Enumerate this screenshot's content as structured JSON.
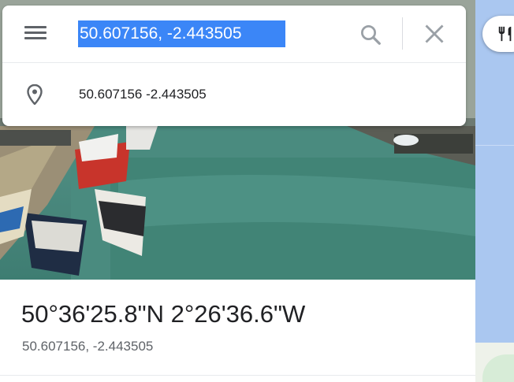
{
  "search": {
    "query": "50.607156, -2.443505",
    "menu_icon": "hamburger-menu-icon",
    "search_icon": "search-icon",
    "close_icon": "close-icon"
  },
  "suggestion": {
    "icon": "location-pin-icon",
    "text": "50.607156 -2.443505"
  },
  "place": {
    "title": "50°36'25.8\"N 2°26'36.6\"W",
    "coordinates": "50.607156, -2.443505"
  },
  "map": {
    "restaurants_icon": "restaurant-icon"
  },
  "colors": {
    "selection": "#3b86f7",
    "icon_gray": "#5f6368",
    "map_water": "#aac7f0"
  }
}
